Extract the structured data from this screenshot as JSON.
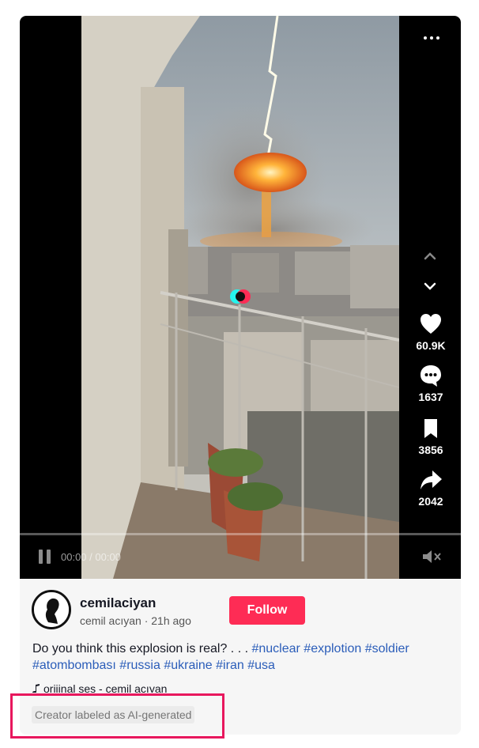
{
  "video": {
    "time_display": "00:00 / 00:00",
    "progress": 0
  },
  "actions": {
    "likes": "60.9K",
    "comments": "1637",
    "saves": "3856",
    "shares": "2042"
  },
  "author": {
    "username": "cemilaciyan",
    "display_name": "cemil acıyan",
    "posted": "21h ago",
    "separator": " · "
  },
  "follow_label": "Follow",
  "caption": {
    "text": "Do you think this explosion is real? . . . ",
    "hashtags": [
      "#nuclear",
      "#explotion",
      "#soldier",
      "#atombombası",
      "#russia",
      "#ukraine",
      "#iran",
      "#usa"
    ]
  },
  "music": "orijinal ses - cemil acıyan",
  "ai_label": "Creator labeled as AI-generated",
  "colors": {
    "accent": "#fe2c55",
    "hashtag": "#2b5db9",
    "highlight": "#e8175d"
  },
  "icons": [
    "more-icon",
    "chevron-up-icon",
    "chevron-down-icon",
    "heart-icon",
    "comment-icon",
    "bookmark-icon",
    "share-icon",
    "pause-icon",
    "mute-icon",
    "music-note-icon"
  ]
}
